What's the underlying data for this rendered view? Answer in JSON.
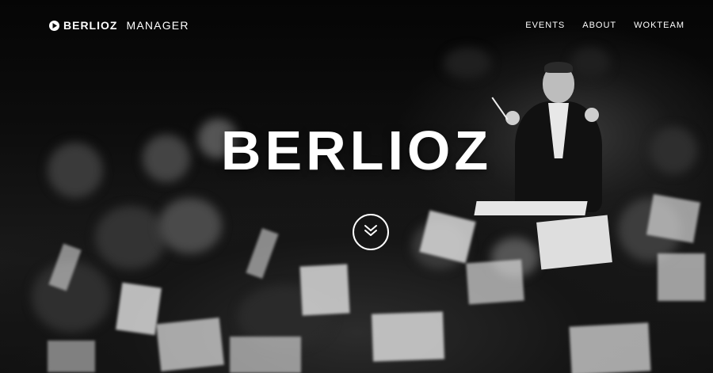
{
  "header": {
    "brand_name": "BERLIOZ",
    "brand_sub": "MANAGER",
    "brand_icon": "play-icon"
  },
  "nav": {
    "items": [
      {
        "label": "EVENTS"
      },
      {
        "label": "ABOUT"
      },
      {
        "label": "WOKTEAM"
      }
    ]
  },
  "hero": {
    "title": "BERLIOZ",
    "scroll_icon": "double-chevron-down-icon",
    "background": "orchestra-photo"
  },
  "colors": {
    "text": "#ffffff",
    "background": "#0a0a0a"
  }
}
